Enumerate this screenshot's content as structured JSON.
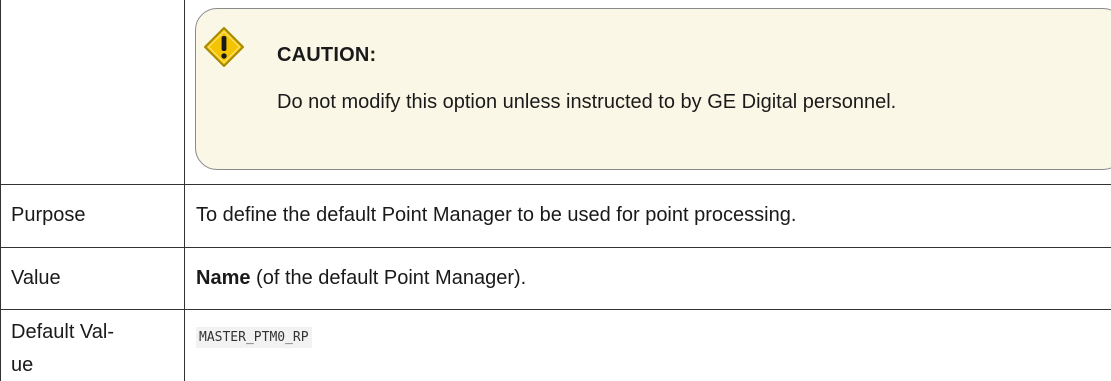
{
  "caution": {
    "icon": "warning-diamond-icon",
    "title": "CAUTION:",
    "text": "Do not modify this option unless instructed to by GE Digital personnel."
  },
  "rows": [
    {
      "label": "Purpose",
      "value": "To define the default Point Manager to be used for point processing."
    },
    {
      "label": "Value",
      "value_bold": "Name",
      "value_rest": " (of the default Point Manager)."
    },
    {
      "label_line1": "Default Val-",
      "label_line2": "ue",
      "value_code": "MASTER_PTM0_RP"
    }
  ],
  "colors": {
    "caution_bg": "#fbf7e7",
    "icon_fill": "#f5c400",
    "border": "#333333"
  }
}
